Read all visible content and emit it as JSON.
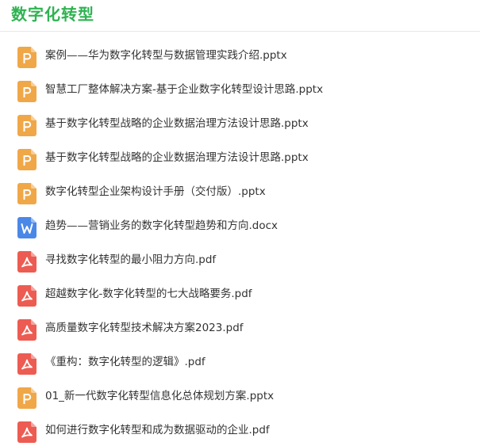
{
  "header": {
    "title": "数字化转型"
  },
  "colors": {
    "title": "#2eb351",
    "ppt_icon": "#f0a748",
    "doc_icon": "#4a88e8",
    "pdf_icon": "#ec5c52"
  },
  "files": [
    {
      "name": "案例——华为数字化转型与数据管理实践介绍.pptx",
      "type": "ppt",
      "icon": "ppt-file-icon"
    },
    {
      "name": "智慧工厂整体解决方案-基于企业数字化转型设计思路.pptx",
      "type": "ppt",
      "icon": "ppt-file-icon"
    },
    {
      "name": "基于数字化转型战略的企业数据治理方法设计思路.pptx",
      "type": "ppt",
      "icon": "ppt-file-icon"
    },
    {
      "name": "基于数字化转型战略的企业数据治理方法设计思路.pptx",
      "type": "ppt",
      "icon": "ppt-file-icon"
    },
    {
      "name": "数字化转型企业架构设计手册（交付版）.pptx",
      "type": "ppt",
      "icon": "ppt-file-icon"
    },
    {
      "name": "趋势——营销业务的数字化转型趋势和方向.docx",
      "type": "doc",
      "icon": "word-file-icon"
    },
    {
      "name": "寻找数字化转型的最小阻力方向.pdf",
      "type": "pdf",
      "icon": "pdf-file-icon"
    },
    {
      "name": "超越数字化-数字化转型的七大战略要务.pdf",
      "type": "pdf",
      "icon": "pdf-file-icon"
    },
    {
      "name": "高质量数字化转型技术解决方案2023.pdf",
      "type": "pdf",
      "icon": "pdf-file-icon"
    },
    {
      "name": "《重构：数字化转型的逻辑》.pdf",
      "type": "pdf",
      "icon": "pdf-file-icon"
    },
    {
      "name": "01_新一代数字化转型信息化总体规划方案.pptx",
      "type": "ppt",
      "icon": "ppt-file-icon"
    },
    {
      "name": "如何进行数字化转型和成为数据驱动的企业.pdf",
      "type": "pdf",
      "icon": "pdf-file-icon"
    }
  ]
}
